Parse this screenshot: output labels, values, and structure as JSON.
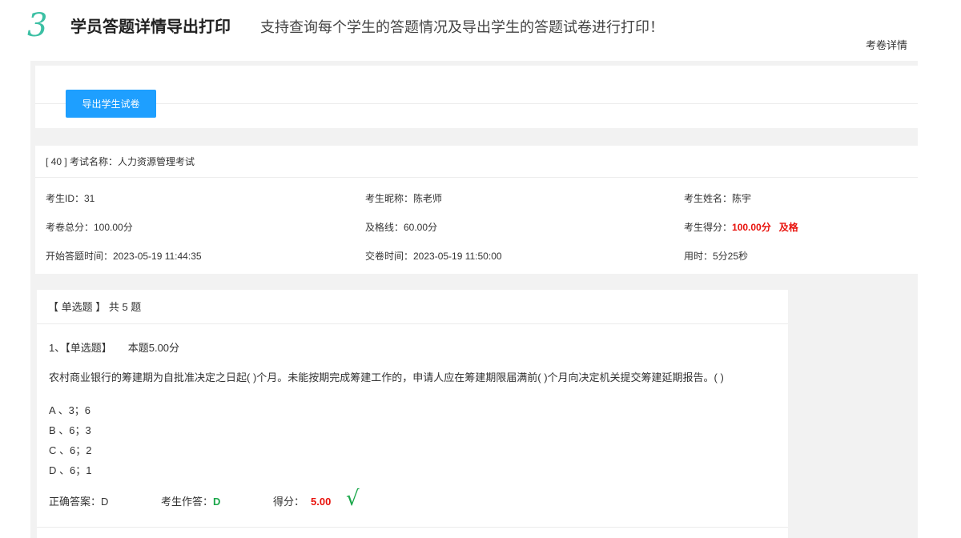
{
  "header": {
    "step_number": "3",
    "feature_title": "学员答题详情导出打印",
    "feature_desc": "支持查询每个学生的答题情况及导出学生的答题试卷进行打印！",
    "page_label": "考卷详情"
  },
  "toolbar": {
    "export_button_label": "导出学生试卷"
  },
  "exam": {
    "heading": "[ 40 ] 考试名称：人力资源管理考试",
    "student_id": "考生ID：31",
    "student_nickname": "考生昵称：陈老师",
    "student_name": "考生姓名：陈宇",
    "total_score": "考卷总分：100.00分",
    "pass_line": "及格线：60.00分",
    "student_score_label": "考生得分：",
    "student_score_value": "100.00分",
    "pass_status": "及格",
    "start_time": "开始答题时间：2023-05-19 11:44:35",
    "submit_time": "交卷时间：2023-05-19 11:50:00",
    "duration": "用时：5分25秒"
  },
  "question_section": {
    "heading": "【 单选题 】 共 5 题",
    "questions": [
      {
        "title": "1、【单选题】",
        "points": "本题5.00分",
        "stem": "农村商业银行的筹建期为自批准决定之日起( )个月。未能按期完成筹建工作的，申请人应在筹建期限届满前( )个月向决定机关提交筹建延期报告。( )",
        "options": [
          "A 、3；6",
          "B 、6；3",
          "C 、6；2",
          "D 、6；1"
        ],
        "correct_label": "正确答案：",
        "correct_value": "D",
        "student_label": "考生作答：",
        "student_value": "D",
        "score_label": "得分：",
        "score_value": "5.00",
        "result_mark": "√"
      }
    ]
  },
  "colors": {
    "accent_teal": "#3cc0a4",
    "button_blue": "#1e9fff",
    "score_red": "#e8120c",
    "correct_green": "#1aa74a"
  },
  "icons": {
    "result": "check-mark-icon"
  }
}
